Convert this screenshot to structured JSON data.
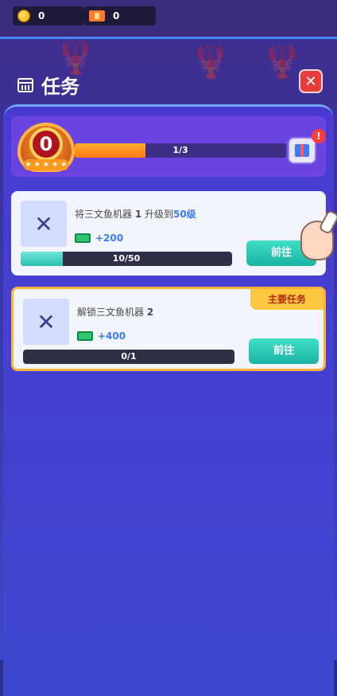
{
  "topbar": {
    "coins": "0",
    "tickets": "0"
  },
  "header": {
    "title": "任务"
  },
  "progress": {
    "level": "0",
    "stars": [
      "★",
      "★",
      "★",
      "★",
      "★"
    ],
    "bar_text": "1/3",
    "fill_fraction": 0.333,
    "gift_alert": "!"
  },
  "tasks": [
    {
      "title_prefix": "将三文鱼机器",
      "title_num": "1",
      "title_mid": "升级到",
      "title_target": "50级",
      "reward": "+200",
      "progress_text": "10/50",
      "fill_fraction": 0.2,
      "button": "前往"
    },
    {
      "title_prefix": "解锁三文鱼机器",
      "title_num": "2",
      "reward": "+400",
      "progress_text": "0/1",
      "fill_fraction": 0,
      "button": "前往",
      "tag": "主要任务"
    }
  ],
  "colors": {
    "accent": "#3b7cff",
    "go_button": "#19b3a3",
    "close": "#e63c3c",
    "tag": "#ffc840"
  }
}
